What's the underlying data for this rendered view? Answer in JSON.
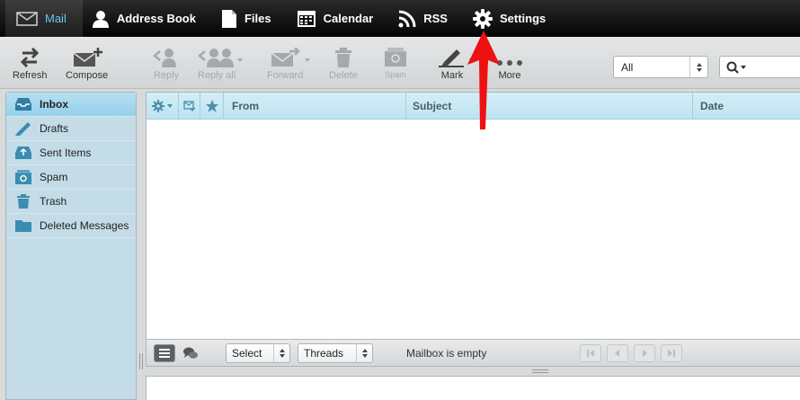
{
  "nav": {
    "items": [
      {
        "label": "Mail",
        "icon": "mail-icon",
        "active": true
      },
      {
        "label": "Address Book",
        "icon": "person-icon"
      },
      {
        "label": "Files",
        "icon": "file-icon"
      },
      {
        "label": "Calendar",
        "icon": "calendar-icon"
      },
      {
        "label": "RSS",
        "icon": "rss-icon"
      },
      {
        "label": "Settings",
        "icon": "gear-icon"
      }
    ]
  },
  "toolbar": {
    "refresh": "Refresh",
    "compose": "Compose",
    "reply": "Reply",
    "reply_all": "Reply all",
    "forward": "Forward",
    "delete": "Delete",
    "spam": "Spam",
    "mark": "Mark",
    "more": "More",
    "filter_value": "All"
  },
  "folders": [
    {
      "label": "Inbox",
      "icon": "inbox-icon",
      "selected": true
    },
    {
      "label": "Drafts",
      "icon": "pencil-icon"
    },
    {
      "label": "Sent Items",
      "icon": "sent-icon"
    },
    {
      "label": "Spam",
      "icon": "spam-icon"
    },
    {
      "label": "Trash",
      "icon": "trash-icon"
    },
    {
      "label": "Deleted Messages",
      "icon": "folder-icon"
    }
  ],
  "list": {
    "columns": {
      "from": "From",
      "subject": "Subject",
      "date": "Date"
    },
    "footer": {
      "select": "Select",
      "threads": "Threads",
      "status": "Mailbox is empty"
    }
  },
  "colors": {
    "accent": "#6cc4ef",
    "annotation_arrow": "#ee1111"
  }
}
